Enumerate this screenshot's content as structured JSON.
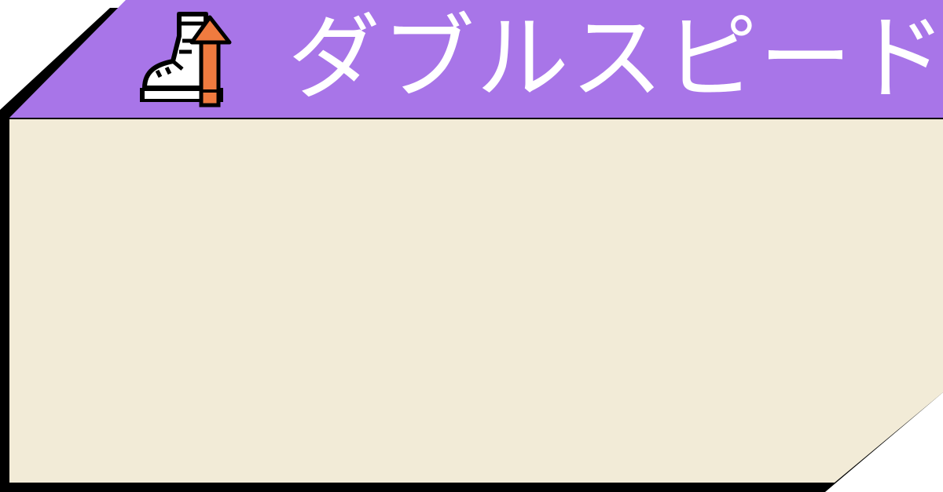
{
  "card": {
    "title": "ダブルスピード",
    "icon": "speed-boot-arrow-icon"
  },
  "colors": {
    "header": "#a875e8",
    "body": "#f2ebd7",
    "border": "#000000",
    "title_text": "#ffffff",
    "icon_arrow": "#f07b3f",
    "icon_outline": "#000000",
    "icon_boot": "#ffffff"
  }
}
